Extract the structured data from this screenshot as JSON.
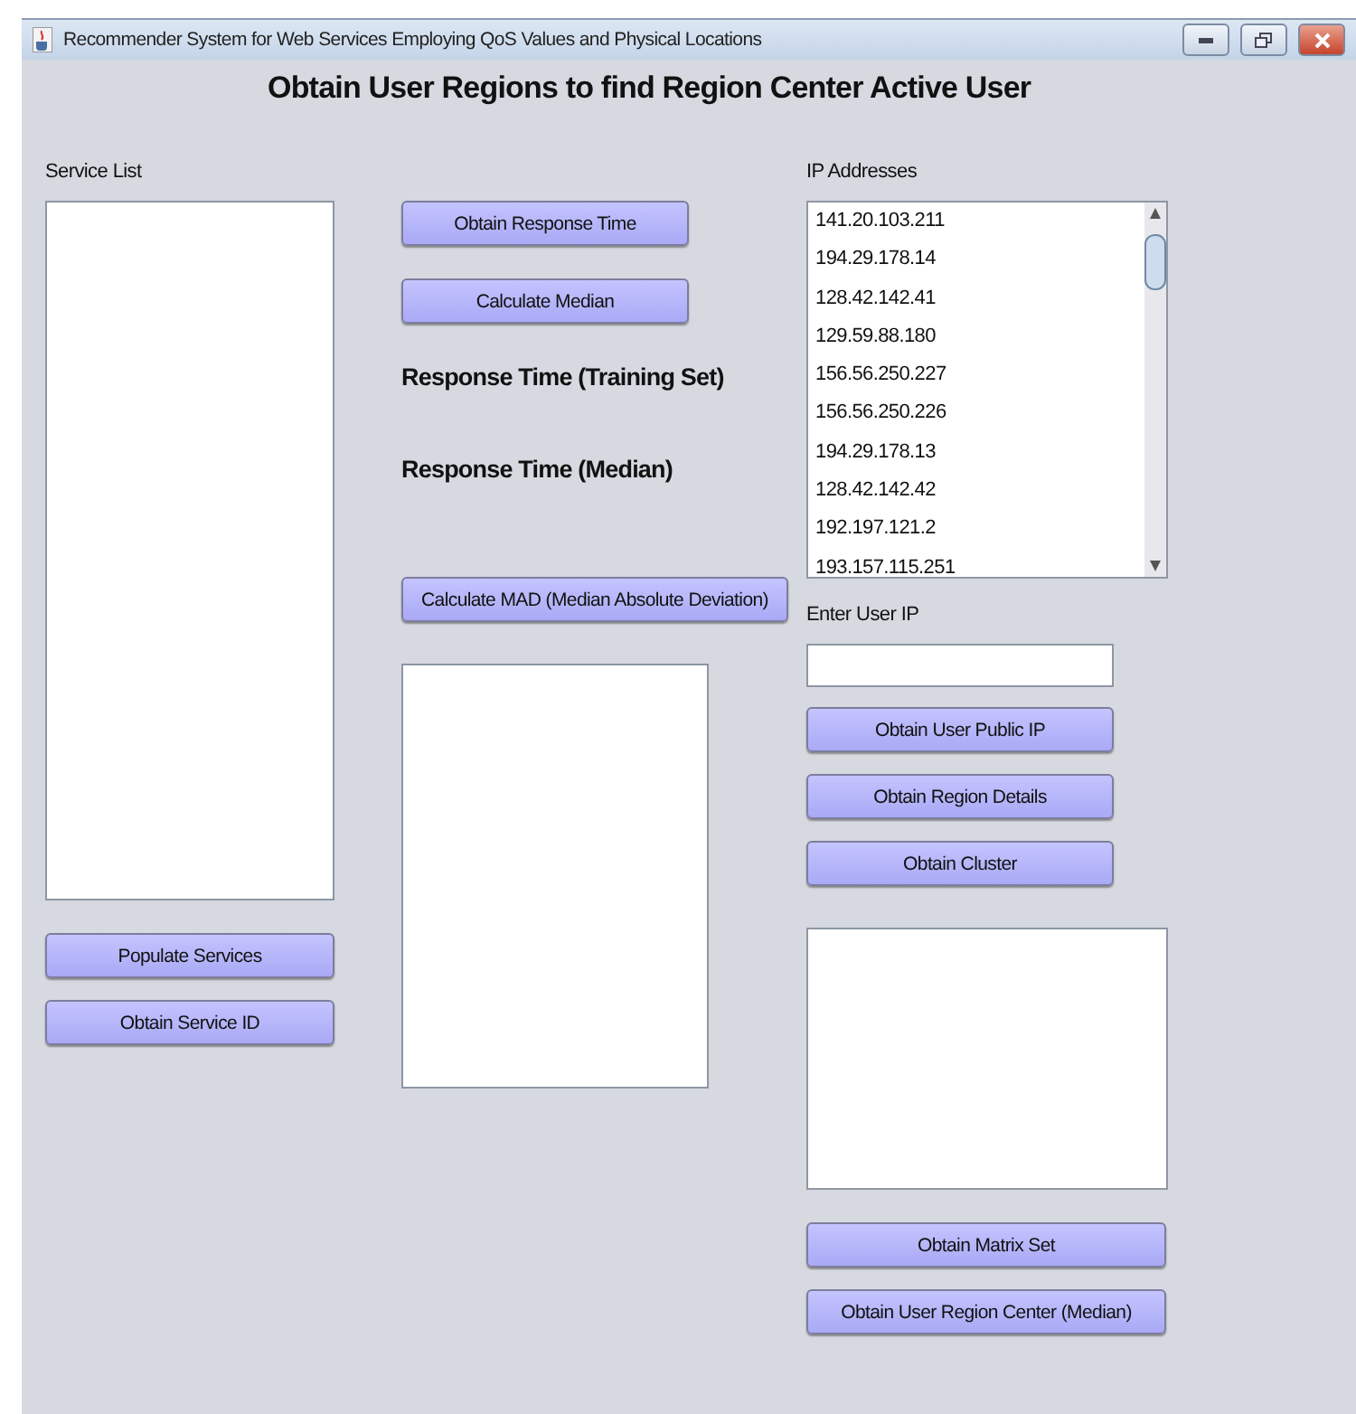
{
  "window": {
    "title": "Recommender System for Web Services Employing QoS Values and Physical Locations"
  },
  "heading": "Obtain User Regions to find Region Center Active User",
  "service_panel": {
    "label": "Service List",
    "buttons": [
      "Populate Services",
      "Obtain Service ID"
    ]
  },
  "response_panel": {
    "buttons": [
      "Obtain Response Time",
      "Calculate Median"
    ],
    "labels": [
      "Response Time (Training Set)",
      "Response Time (Median)"
    ],
    "mad_button": "Calculate MAD (Median Absolute Deviation)"
  },
  "ip_panel": {
    "label": "IP Addresses",
    "addresses": [
      "141.20.103.211",
      "194.29.178.14",
      "128.42.142.41",
      "129.59.88.180",
      "156.56.250.227",
      "156.56.250.226",
      "194.29.178.13",
      "128.42.142.42",
      "192.197.121.2",
      "193.157.115.251"
    ],
    "user_ip_label": "Enter User IP",
    "buttons": [
      "Obtain User Public IP",
      "Obtain Region Details",
      "Obtain Cluster"
    ],
    "bottom_buttons": [
      "Obtain Matrix Set",
      "Obtain User Region Center (Median)"
    ]
  }
}
